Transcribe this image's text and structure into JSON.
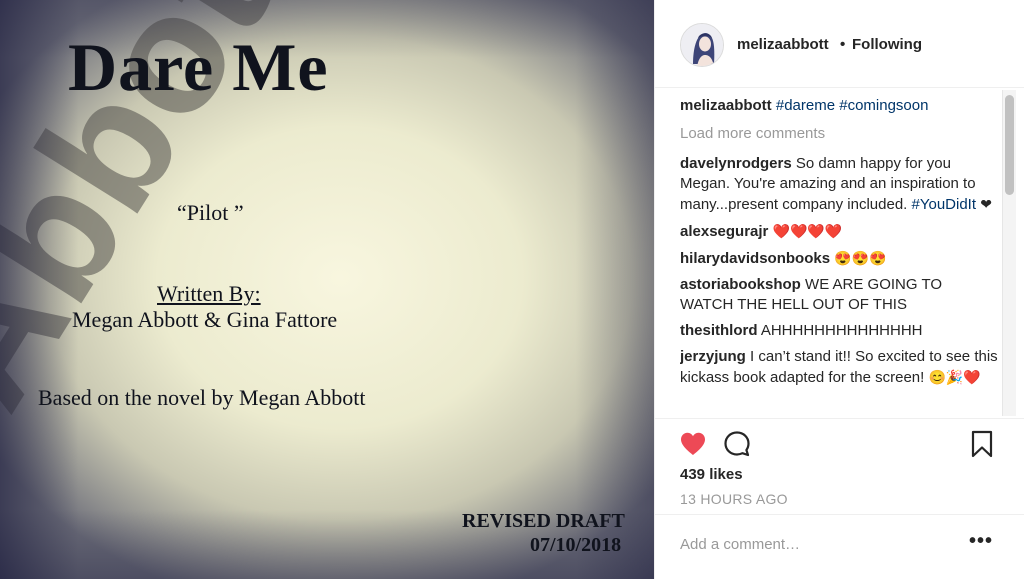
{
  "photo": {
    "watermark": "Abbott, Me",
    "title": "Dare Me",
    "episode": "“Pilot ”",
    "written_by": "Written By:",
    "authors": "Megan Abbott & Gina Fattore",
    "based_on": "Based on the novel by Megan Abbott",
    "draft": "REVISED DRAFT",
    "date": "07/10/2018"
  },
  "header": {
    "username": "melizaabbott",
    "separator": "•",
    "follow_status": "Following",
    "avatar_icon": "profile-avatar-icon"
  },
  "caption": {
    "user": "melizaabbott",
    "text": "#dareme #comingsoon"
  },
  "load_more": "Load more comments",
  "comments": [
    {
      "user": "davelynrodgers",
      "text": "So damn happy for you Megan. You're amazing and an inspiration to many...present company included. ",
      "tag": "#YouDidIt",
      "suffix": "❤"
    },
    {
      "user": "alexsegurajr",
      "text": "",
      "tag": "",
      "suffix": "❤️❤️❤️❤️"
    },
    {
      "user": "hilarydavidsonbooks",
      "text": "",
      "tag": "",
      "suffix": "😍😍😍"
    },
    {
      "user": "astoriabookshop",
      "text": "WE ARE GOING TO WATCH THE HELL OUT OF THIS",
      "tag": "",
      "suffix": ""
    },
    {
      "user": "thesithlord",
      "text": "AHHHHHHHHHHHHHH",
      "tag": "",
      "suffix": ""
    },
    {
      "user": "jerzyjung",
      "text": "I can’t stand it!! So excited to see this kickass book adapted for the screen! ",
      "tag": "",
      "suffix": "😊🎉❤️"
    }
  ],
  "actions": {
    "like_icon": "heart-icon",
    "like_color": "#ed4956",
    "comment_icon": "comment-bubble-icon",
    "save_icon": "bookmark-icon"
  },
  "likes": "439 likes",
  "timestamp": "13 HOURS AGO",
  "add_comment": {
    "placeholder": "Add a comment…",
    "more_label": "•••"
  }
}
